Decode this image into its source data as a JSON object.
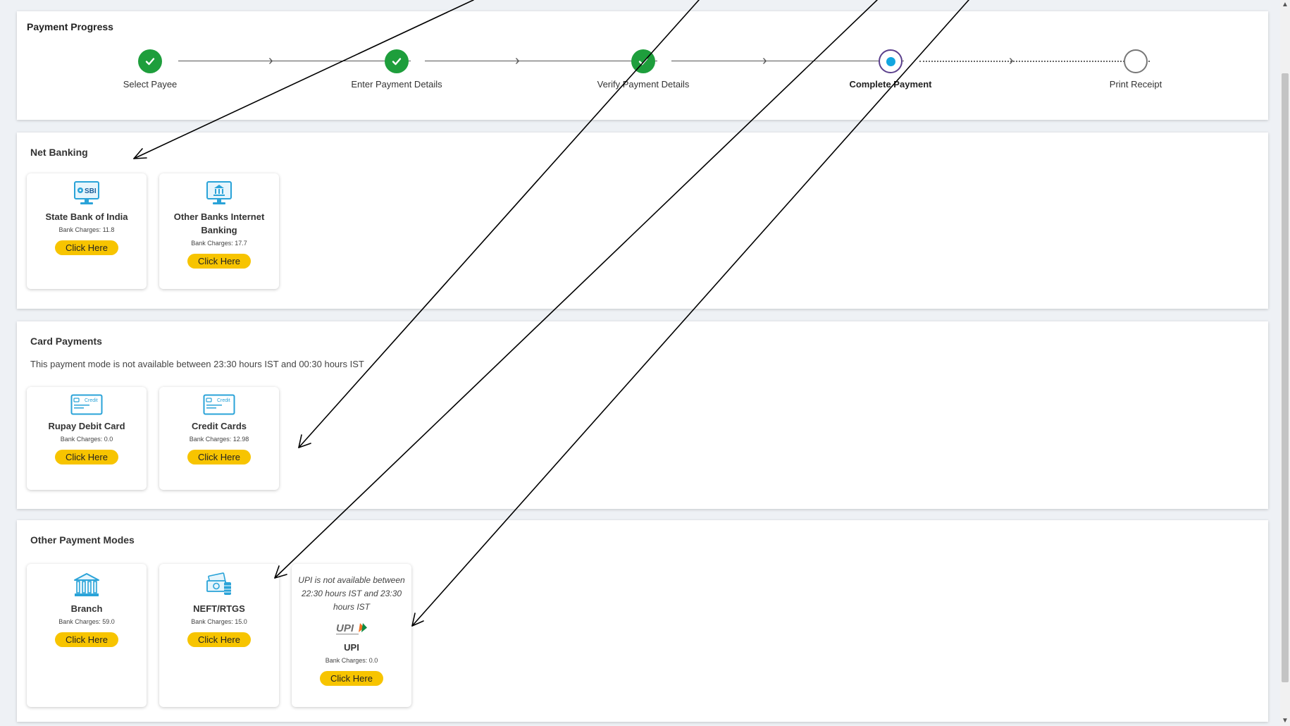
{
  "progress": {
    "title": "Payment Progress",
    "steps": [
      {
        "label": "Select Payee",
        "state": "done"
      },
      {
        "label": "Enter Payment Details",
        "state": "done"
      },
      {
        "label": "Verify Payment Details",
        "state": "done"
      },
      {
        "label": "Complete Payment",
        "state": "current"
      },
      {
        "label": "Print Receipt",
        "state": "todo"
      }
    ]
  },
  "net_banking": {
    "title": "Net Banking",
    "cards": [
      {
        "name": "State Bank of India",
        "charges": "Bank Charges: 11.8",
        "button": "Click Here",
        "icon": "sbi-monitor-icon"
      },
      {
        "name": "Other Banks Internet Banking",
        "charges": "Bank Charges: 17.7",
        "button": "Click Here",
        "icon": "bank-monitor-icon"
      }
    ]
  },
  "card_payments": {
    "title": "Card Payments",
    "notice": "This payment mode is not available between 23:30 hours IST and 00:30 hours IST",
    "cards": [
      {
        "name": "Rupay Debit Card",
        "charges": "Bank Charges: 0.0",
        "button": "Click Here",
        "icon": "credit-card-icon",
        "card_text": "Credit"
      },
      {
        "name": "Credit Cards",
        "charges": "Bank Charges: 12.98",
        "button": "Click Here",
        "icon": "credit-card-icon",
        "card_text": "Credit"
      }
    ]
  },
  "other_modes": {
    "title": "Other Payment Modes",
    "cards": [
      {
        "name": "Branch",
        "charges": "Bank Charges: 59.0",
        "button": "Click Here",
        "icon": "bank-building-icon"
      },
      {
        "name": "NEFT/RTGS",
        "charges": "Bank Charges: 15.0",
        "button": "Click Here",
        "icon": "cash-stack-icon"
      },
      {
        "name": "UPI",
        "charges": "Bank Charges: 0.0",
        "button": "Click Here",
        "icon": "upi-logo-icon",
        "logo_text": "UPI",
        "note": "UPI is not available between 22:30 hours IST and 23:30 hours IST"
      }
    ]
  },
  "colors": {
    "button": "#f7c400",
    "done": "#1e9e3c",
    "current_dot": "#12a6e0",
    "icon": "#2aa3d8"
  }
}
